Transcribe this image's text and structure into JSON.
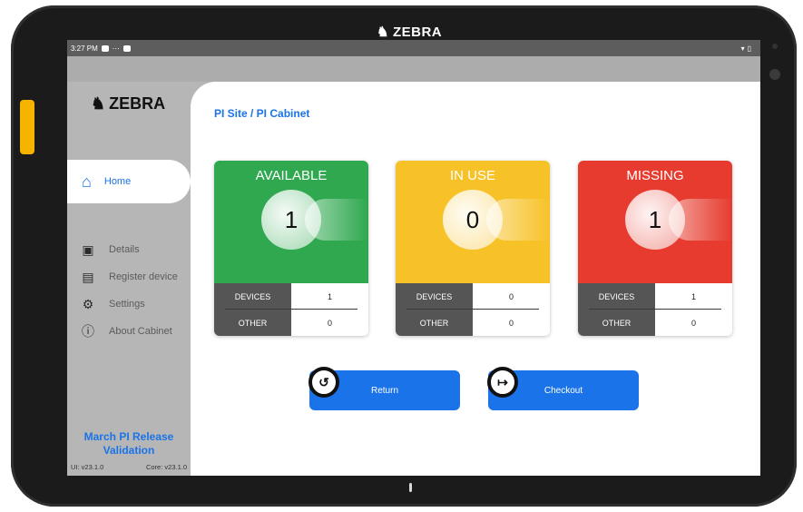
{
  "device": {
    "brand": "ZEBRA"
  },
  "statusbar": {
    "time": "3:27 PM"
  },
  "sidebar": {
    "brand": "ZEBRA",
    "home_label": "Home",
    "items": [
      {
        "label": "Details",
        "icon": "cabinet-icon"
      },
      {
        "label": "Register device",
        "icon": "register-device-icon"
      },
      {
        "label": "Settings",
        "icon": "settings-icon"
      },
      {
        "label": "About Cabinet",
        "icon": "info-icon"
      }
    ],
    "release_line1": "March PI Release",
    "release_line2": "Validation",
    "ui_version": "UI: v23.1.0",
    "core_version": "Core: v23.1.0"
  },
  "breadcrumb": "PI Site / PI Cabinet",
  "cards": [
    {
      "title": "AVAILABLE",
      "count": "1",
      "color": "#2fa84f",
      "devices_label": "DEVICES",
      "devices_value": "1",
      "other_label": "OTHER",
      "other_value": "0"
    },
    {
      "title": "IN USE",
      "count": "0",
      "color": "#f7c228",
      "devices_label": "DEVICES",
      "devices_value": "0",
      "other_label": "OTHER",
      "other_value": "0"
    },
    {
      "title": "MISSING",
      "count": "1",
      "color": "#e63b2e",
      "devices_label": "DEVICES",
      "devices_value": "1",
      "other_label": "OTHER",
      "other_value": "0"
    }
  ],
  "actions": {
    "return_label": "Return",
    "checkout_label": "Checkout"
  },
  "colors": {
    "accent": "#1a73e8",
    "sidebar": "#b6b6b6"
  }
}
